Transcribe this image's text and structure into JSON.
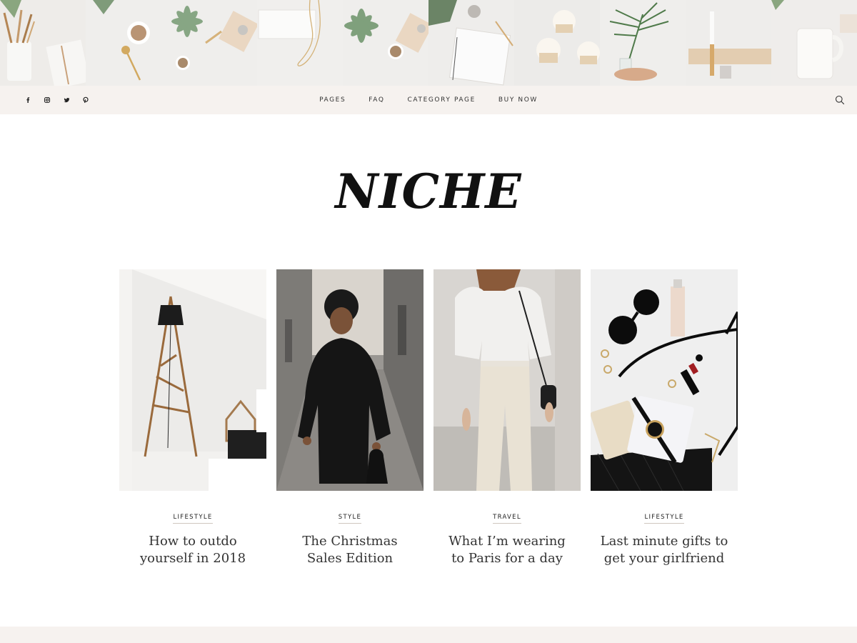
{
  "social": {
    "items": [
      {
        "icon": "facebook-icon"
      },
      {
        "icon": "instagram-icon"
      },
      {
        "icon": "twitter-icon"
      },
      {
        "icon": "pinterest-icon"
      }
    ]
  },
  "nav": {
    "items": [
      "PAGES",
      "FAQ",
      "CATEGORY PAGE",
      "BUY NOW"
    ],
    "search_icon": "search-icon"
  },
  "logo": {
    "text": "NICHE"
  },
  "posts": [
    {
      "category": "LIFESTYLE",
      "title": "How to outdo yourself in 2018"
    },
    {
      "category": "STYLE",
      "title": "The Christmas Sales Edition"
    },
    {
      "category": "TRAVEL",
      "title": "What I’m wearing to Paris for a day"
    },
    {
      "category": "LIFESTYLE",
      "title": "Last minute gifts to get your girlfriend"
    }
  ],
  "colors": {
    "nav_background": "#f6f2ef",
    "text": "#333333",
    "logo": "#111111"
  }
}
